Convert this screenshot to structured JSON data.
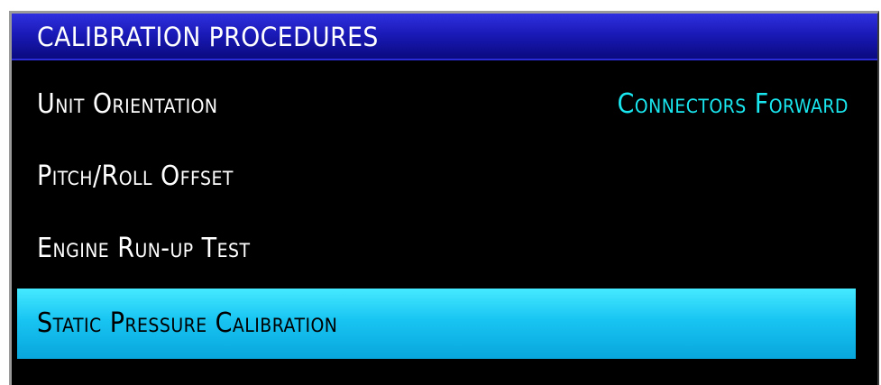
{
  "window": {
    "title": "CALIBRATION PROCEDURES"
  },
  "menu": {
    "items": [
      {
        "label": "Unit Orientation",
        "value": "Connectors Forward"
      },
      {
        "label": "Pitch/Roll Offset"
      },
      {
        "label": "Engine Run-up Test"
      },
      {
        "label": "Static Pressure Calibration",
        "selected": true
      }
    ]
  },
  "colors": {
    "title_bar": "#1a1ab8",
    "background": "#000000",
    "value_text": "#19e6ee",
    "selection": "#18c4f2"
  }
}
